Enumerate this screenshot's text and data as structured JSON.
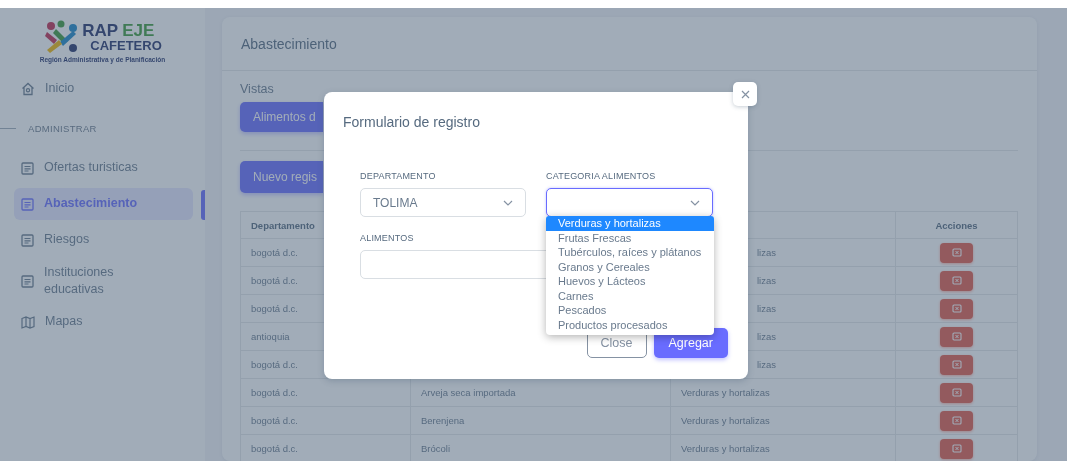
{
  "sidebar": {
    "logo": {
      "word_1": "RAP",
      "word_2": "EJE",
      "word_3": "CAFETERO",
      "subtitle": "Región Administrativa y de Planificación"
    },
    "items": [
      {
        "kind": "home",
        "label": "Inicio",
        "selected": false
      },
      {
        "kind": "section",
        "label": "ADMINISTRAR"
      },
      {
        "kind": "doc",
        "label": "Ofertas turisticas",
        "selected": false
      },
      {
        "kind": "doc",
        "label": "Abastecimiento",
        "selected": true
      },
      {
        "kind": "doc",
        "label": "Riesgos",
        "selected": false
      },
      {
        "kind": "doc",
        "label": "Instituciones educativas",
        "selected": false
      },
      {
        "kind": "map",
        "label": "Mapas",
        "selected": false
      }
    ]
  },
  "page": {
    "title": "Abastecimiento",
    "views_label": "Vistas",
    "view_button": "Alimentos d",
    "new_button": "Nuevo regis"
  },
  "table": {
    "column_1": "Departamento",
    "column_4": "Acciones",
    "rows": [
      {
        "column_1": "bogotá d.c.",
        "column_3": "lizas",
        "column_3_cut": true
      },
      {
        "column_1": "bogotá d.c.",
        "column_3": "lizas",
        "column_3_cut": true
      },
      {
        "column_1": "bogotá d.c.",
        "column_3": "lizas",
        "column_3_cut": true
      },
      {
        "column_1": "antioquia",
        "column_3": "lizas",
        "column_3_cut": true
      },
      {
        "column_1": "bogotá d.c.",
        "column_3": "lizas",
        "column_3_cut": true
      },
      {
        "column_1": "bogotá d.c.",
        "column_2": "Arveja seca importada",
        "column_3": "Verduras y hortalizas",
        "column_3_cut": false
      },
      {
        "column_1": "bogotá d.c.",
        "column_2": "Berenjena",
        "column_3": "Verduras y hortalizas",
        "column_3_cut": false
      },
      {
        "column_1": "bogotá d.c.",
        "column_2": "Brócoli",
        "column_3": "Verduras y hortalizas",
        "column_3_cut": false
      }
    ]
  },
  "modal": {
    "title": "Formulario de registro",
    "fields": [
      {
        "kind": "select",
        "label": "DEPARTAMENTO",
        "value": "TOLIMA",
        "focused": false
      },
      {
        "kind": "select",
        "label": "CATEGORIA ALIMENTOS",
        "focused": true,
        "options": [
          {
            "label": "Verduras y hortalizas",
            "selected": true
          },
          {
            "label": "Frutas Frescas",
            "selected": false
          },
          {
            "label": "Tubérculos, raíces y plátanos",
            "selected": false
          },
          {
            "label": "Granos y Cereales",
            "selected": false
          },
          {
            "label": "Huevos y Lácteos",
            "selected": false
          },
          {
            "label": "Carnes",
            "selected": false
          },
          {
            "label": "Pescados",
            "selected": false
          },
          {
            "label": "Productos procesados",
            "selected": false
          }
        ]
      },
      {
        "kind": "input",
        "label": "ALIMENTOS"
      }
    ],
    "buttons": [
      {
        "kind": "secondary",
        "label": "Close"
      },
      {
        "kind": "primary",
        "label": "Agregar"
      }
    ]
  }
}
